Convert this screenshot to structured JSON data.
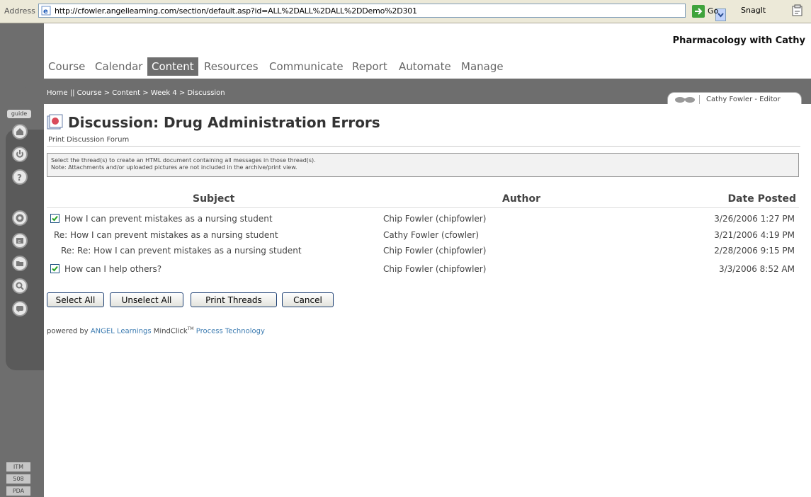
{
  "browser": {
    "address_label": "Address",
    "url": "http://cfowler.angellearning.com/section/default.asp?id=ALL%2DALL%2DALL%2DDemo%2D301",
    "go_label": "Go",
    "snagit_label": "SnagIt"
  },
  "rail": {
    "guide_label": "guide",
    "icons": [
      "home-icon",
      "power-icon",
      "help-icon",
      "settings-icon",
      "email-icon",
      "folder-icon",
      "search-icon",
      "chat-icon"
    ],
    "bottom_links": [
      "ITM",
      "508",
      "PDA"
    ]
  },
  "header": {
    "course_title": "Pharmacology with Cathy",
    "nav": [
      "Course",
      "Calendar",
      "Content",
      "Resources",
      "Communicate",
      "Report",
      "Automate",
      "Manage"
    ],
    "active_nav": "Content"
  },
  "breadcrumb": "Home || Course > Content > Week 4 > Discussion",
  "user": {
    "name": "Cathy Fowler - Editor"
  },
  "page": {
    "title": "Discussion: Drug Administration Errors",
    "subtitle": "Print Discussion Forum",
    "note_lines": [
      "Select the thread(s) to create an HTML document containing all messages in those thread(s).",
      "Note: Attachments and/or uploaded pictures are not included in the archive/print view."
    ]
  },
  "table": {
    "headers": {
      "subject": "Subject",
      "author": "Author",
      "date": "Date Posted"
    },
    "rows": [
      {
        "subject": "How I can prevent mistakes as a nursing student",
        "author": "Chip Fowler (chipfowler)",
        "date": "3/26/2006 1:27 PM",
        "checked": true
      },
      {
        "subject": "Re: How I can prevent mistakes as a nursing student",
        "author": "Cathy Fowler (cfowler)",
        "date": "3/21/2006 4:19 PM",
        "checked": false
      },
      {
        "subject": "Re: Re: How I can prevent mistakes as a nursing student",
        "author": "Chip Fowler (chipfowler)",
        "date": "2/28/2006 9:15 PM",
        "checked": false
      },
      {
        "subject": "How can I help others?",
        "author": "Chip Fowler (chipfowler)",
        "date": "3/3/2006 8:52 AM",
        "checked": true
      }
    ]
  },
  "buttons": {
    "select_all": "Select All",
    "unselect_all": "Unselect All",
    "print_threads": "Print Threads",
    "cancel": "Cancel"
  },
  "footer": {
    "powered_by": "powered by",
    "angel_link": "ANGEL Learnings",
    "mindclick": "MindClick",
    "tm": "TM",
    "process_link": "Process Technology"
  },
  "colors": {
    "rail_gray": "#6e6e6e",
    "link_blue": "#3a7ab0",
    "go_green": "#3fa33c"
  }
}
